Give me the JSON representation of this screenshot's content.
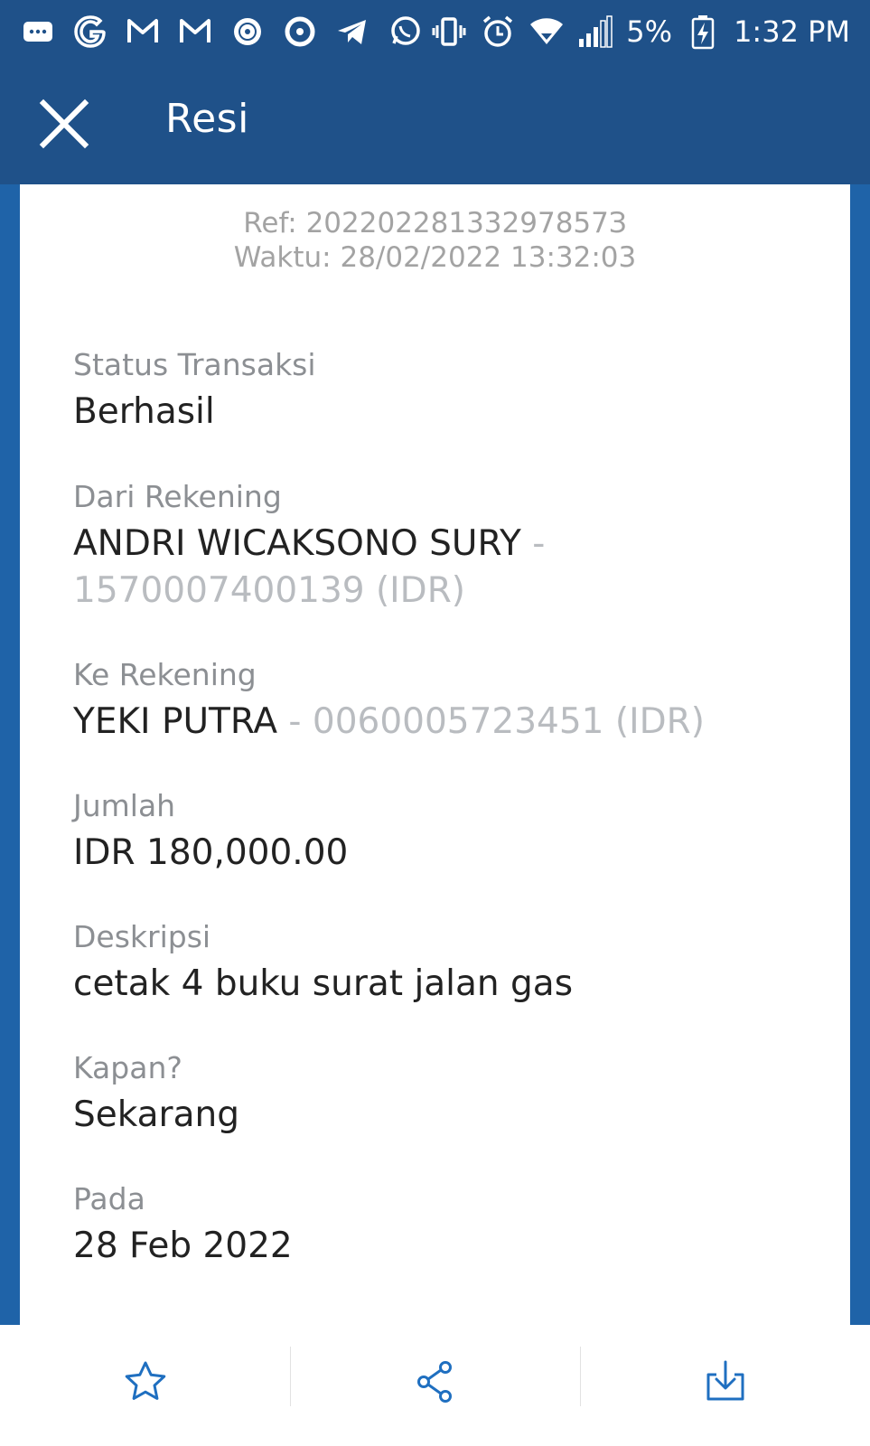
{
  "status_bar": {
    "battery": "5%",
    "time": "1:32 PM",
    "left_icons": [
      "chat-bubble-icon",
      "google-icon",
      "gmail-icon",
      "gmail-icon",
      "quran-app-icon",
      "opera-icon",
      "telegram-icon",
      "whatsapp-icon"
    ],
    "right_icons": [
      "vibrate-icon",
      "alarm-icon",
      "wifi-icon",
      "signal-icon",
      "battery-charging-icon"
    ]
  },
  "app_bar": {
    "title": "Resi",
    "close_icon": "close-icon"
  },
  "receipt": {
    "ref": "Ref: 20220228133297857З",
    "time": "Waktu: 28/02/2022 13:32:03",
    "fields": {
      "status_label": "Status Transaksi",
      "status_value": "Berhasil",
      "from_label": "Dari Rekening",
      "from_name": "ANDRI WICAKSONO SURY",
      "from_sep": " -",
      "from_account": "1570007400139 (IDR)",
      "to_label": "Ke Rekening",
      "to_name": "YEKI PUTRA",
      "to_account": " - 0060005723451 (IDR)",
      "amount_label": "Jumlah",
      "amount_value": "IDR 180,000.00",
      "desc_label": "Deskripsi",
      "desc_value": "cetak 4 buku surat jalan gas",
      "when_label": "Kapan?",
      "when_value": "Sekarang",
      "on_label": "Pada",
      "on_value": "28 Feb 2022"
    }
  },
  "bottom_bar": {
    "buttons": [
      "favorite-star-icon",
      "share-icon",
      "download-icon"
    ]
  },
  "colors": {
    "header": "#1f5189",
    "side": "#1f63a8",
    "accent": "#1f6fc0",
    "label": "#8c8f93",
    "muted": "#b9bcc0"
  }
}
